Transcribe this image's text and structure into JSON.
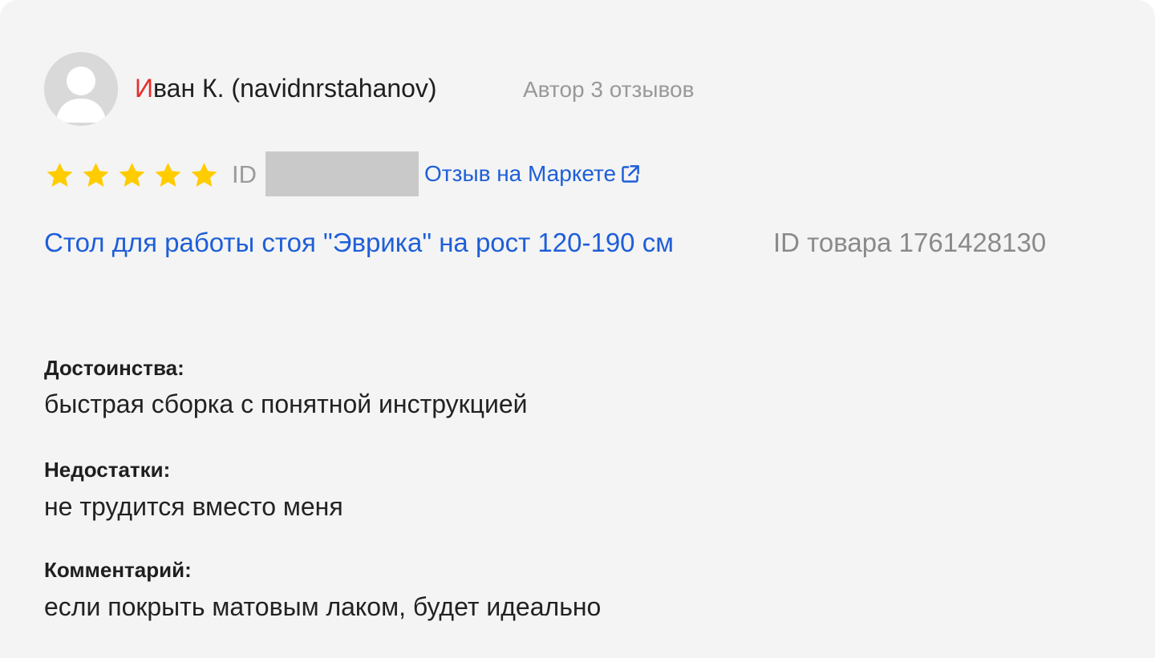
{
  "review": {
    "author": {
      "first_initial": "И",
      "name_rest": "ван К. (navidnrstahanov)",
      "meta": "Автор 3 отзывов",
      "avatar_icon": "user-avatar-icon"
    },
    "rating": {
      "value": 5,
      "max": 5,
      "star_color": "#ffcc00"
    },
    "review_id_label": "ID",
    "market_link": {
      "label": "Отзыв на Маркете",
      "icon": "external-link-icon"
    },
    "product": {
      "title": "Стол для работы стоя \"Эврика\" на рост 120-190 см",
      "id_label": "ID товара 1761428130"
    },
    "sections": {
      "advantages": {
        "label": "Достоинства:",
        "text": "быстрая сборка с понятной инструкцией"
      },
      "disadvantages": {
        "label": "Недостатки:",
        "text": "не трудится вместо меня"
      },
      "comment": {
        "label": "Комментарий:",
        "text": "если покрыть матовым лаком, будет идеально"
      }
    }
  },
  "colors": {
    "link": "#1e5fd8",
    "author_first_letter": "#e62e2e",
    "card_background": "#f4f4f4",
    "muted_text": "#999999"
  }
}
